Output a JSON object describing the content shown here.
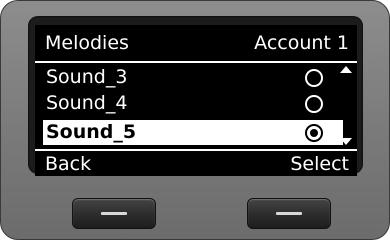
{
  "header": {
    "title": "Melodies",
    "account": "Account 1"
  },
  "list": {
    "items": [
      {
        "label": "Sound_3",
        "selected": false
      },
      {
        "label": "Sound_4",
        "selected": false
      },
      {
        "label": "Sound_5",
        "selected": true
      }
    ]
  },
  "softkeys": {
    "left_label": "Back",
    "right_label": "Select"
  },
  "colors": {
    "screen_background": "#000000",
    "screen_text": "#ffffff",
    "device_body": "#7a7a7a"
  },
  "icons": {
    "radio_unchecked": "radio-empty-icon",
    "radio_checked": "radio-checked-icon",
    "scroll_up": "scroll-up-arrow-icon",
    "scroll_down": "scroll-down-arrow-icon"
  }
}
